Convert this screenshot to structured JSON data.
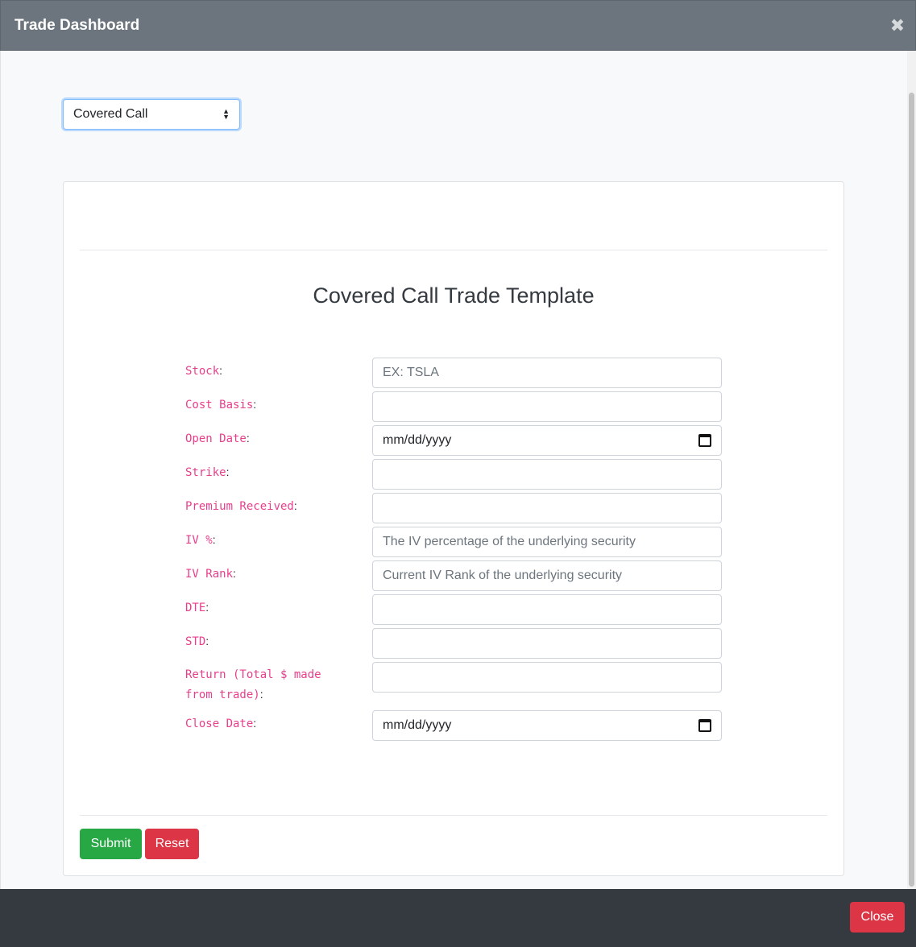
{
  "header": {
    "title": "Trade Dashboard",
    "close_glyph": "✖"
  },
  "strategy_select": {
    "selected": "Covered Call"
  },
  "form": {
    "title": "Covered Call Trade Template",
    "fields": [
      {
        "label": "Stock",
        "value": "",
        "placeholder": "EX: TSLA",
        "type": "text"
      },
      {
        "label": "Cost Basis",
        "value": "",
        "placeholder": "",
        "type": "text"
      },
      {
        "label": "Open Date",
        "value": "mm/dd/yyyy",
        "placeholder": "",
        "type": "date"
      },
      {
        "label": "Strike",
        "value": "",
        "placeholder": "",
        "type": "text"
      },
      {
        "label": "Premium Received",
        "value": "",
        "placeholder": "",
        "type": "text"
      },
      {
        "label": "IV %",
        "value": "",
        "placeholder": "The IV percentage of the underlying security",
        "type": "text"
      },
      {
        "label": "IV Rank",
        "value": "",
        "placeholder": "Current IV Rank of the underlying security",
        "type": "text"
      },
      {
        "label": "DTE",
        "value": "",
        "placeholder": "",
        "type": "text"
      },
      {
        "label": "STD",
        "value": "",
        "placeholder": "",
        "type": "text"
      },
      {
        "label": "Return (Total $ made from trade)",
        "value": "",
        "placeholder": "",
        "type": "text"
      },
      {
        "label": "Close Date",
        "value": "mm/dd/yyyy",
        "placeholder": "",
        "type": "date"
      }
    ],
    "submit_label": "Submit",
    "reset_label": "Reset"
  },
  "footer": {
    "close_label": "Close"
  },
  "colors": {
    "label_pink": "#e83e8c",
    "submit_green": "#28a745",
    "danger_red": "#dc3545",
    "header_gray": "#6c757d"
  },
  "icons": {
    "calendar": "calendar-icon",
    "select_arrows": "chevron-updown-icon"
  }
}
